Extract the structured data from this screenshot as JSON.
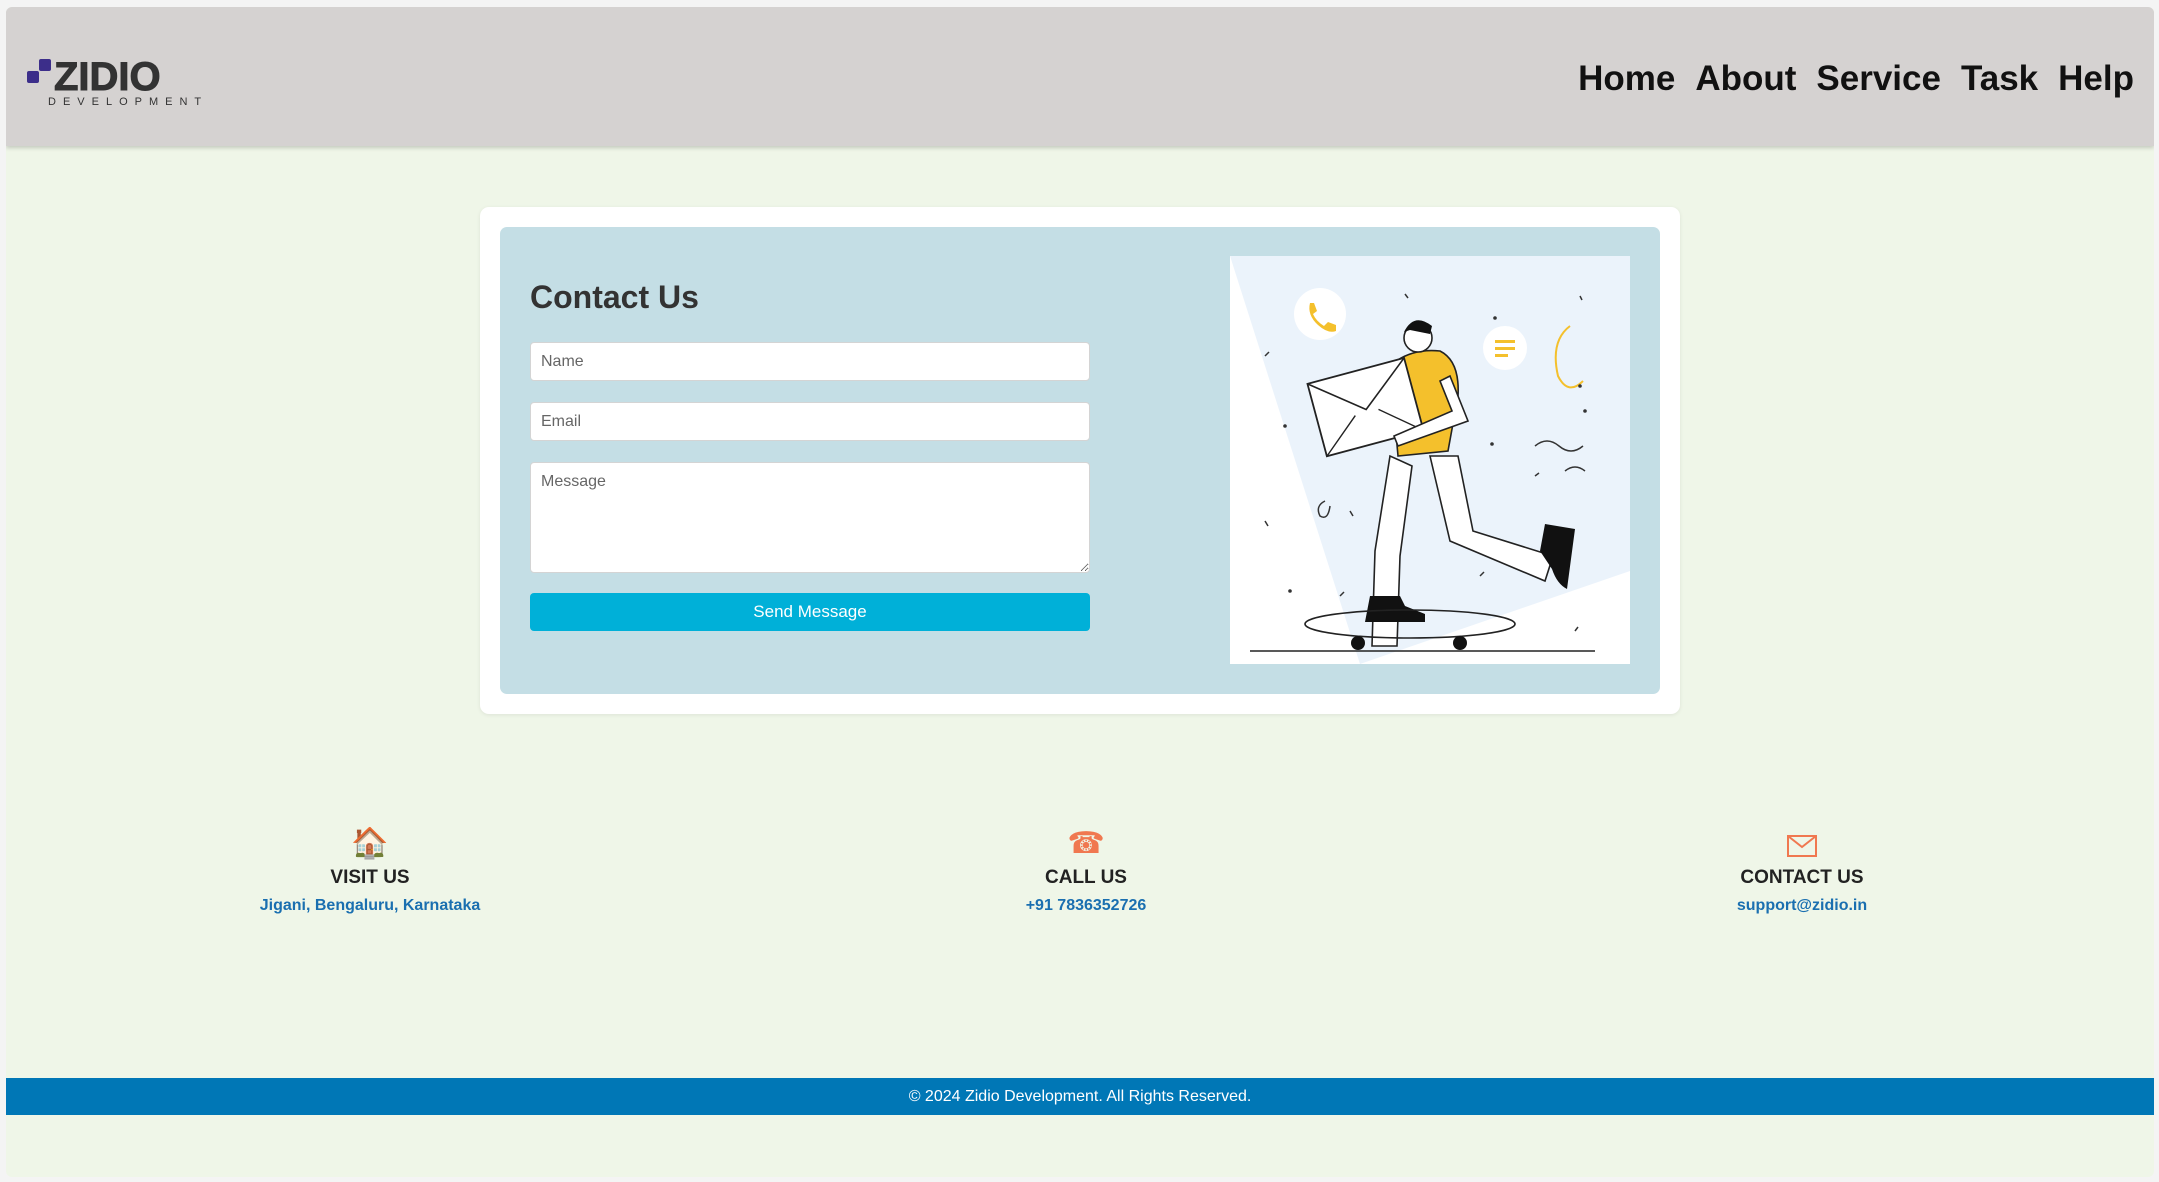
{
  "header": {
    "logo": {
      "name": "ZIDIO",
      "tagline": "DEVELOPMENT"
    },
    "nav": [
      "Home",
      "About",
      "Service",
      "Task",
      "Help"
    ]
  },
  "contact_form": {
    "title": "Contact Us",
    "name_placeholder": "Name",
    "email_placeholder": "Email",
    "message_placeholder": "Message",
    "submit_label": "Send Message"
  },
  "info": [
    {
      "icon": "house-icon",
      "label": "VISIT US",
      "value": "Jigani, Bengaluru, Karnataka"
    },
    {
      "icon": "phone-icon",
      "label": "CALL US",
      "value": "+91 7836352726"
    },
    {
      "icon": "envelope-icon",
      "label": "CONTACT US",
      "value": "support@zidio.in"
    }
  ],
  "footer": {
    "text": "© 2024 Zidio Development. All Rights Reserved."
  },
  "colors": {
    "header_bg": "#d5d2d1",
    "page_bg": "#eff6e8",
    "form_panel_bg": "#c4dee5",
    "button_bg": "#00b0d8",
    "footer_bg": "#0077b6",
    "link_blue": "#1a6fb0",
    "logo_purple": "#3c2e8a"
  }
}
